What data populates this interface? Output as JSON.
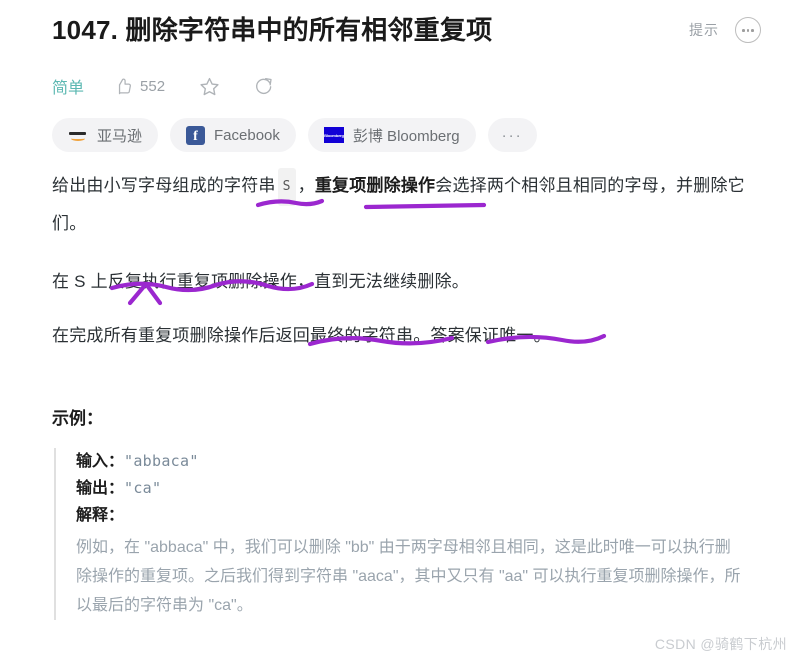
{
  "header": {
    "title": "1047. 删除字符串中的所有相邻重复项",
    "hint_label": "提示",
    "more_icon": "more-horizontal-circle-icon"
  },
  "meta": {
    "difficulty": "简单",
    "likes_icon": "thumbs-up-icon",
    "likes_count": "552",
    "favorite_icon": "star-icon",
    "share_icon": "share-icon"
  },
  "company_tags": {
    "items": [
      {
        "label": "亚马逊",
        "icon": "amazon-logo-icon"
      },
      {
        "label": "Facebook",
        "icon": "facebook-logo-icon"
      },
      {
        "label": "彭博 Bloomberg",
        "icon": "bloomberg-logo-icon"
      }
    ],
    "more_label": "···"
  },
  "description": {
    "p1_a": "给出由小写字母组成的字符串",
    "p1_code": "S",
    "p1_b": "，",
    "p1_bold": "重复项删除操作",
    "p1_c": "会选择两个相邻且相同的字母，并删除它们。",
    "p2": "在 S 上反复执行重复项删除操作，直到无法继续删除。",
    "p3": "在完成所有重复项删除操作后返回最终的字符串。答案保证唯一。"
  },
  "example": {
    "heading": "示例：",
    "input_label": "输入：",
    "input_value": "\"abbaca\"",
    "output_label": "输出：",
    "output_value": "\"ca\"",
    "explain_label": "解释：",
    "explain_text": "例如，在 \"abbaca\" 中，我们可以删除 \"bb\" 由于两字母相邻且相同，这是此时唯一可以执行删除操作的重复项。之后我们得到字符串 \"aaca\"，其中又只有 \"aa\" 可以执行重复项删除操作，所以最后的字符串为 \"ca\"。"
  },
  "watermark": {
    "text": "CSDN @骑鹤下杭州"
  },
  "colors": {
    "difficulty_teal": "#5cb8b2",
    "annotation_purple": "#9b27cf",
    "facebook_blue": "#3b5998",
    "bloomberg_blue": "#1200d6",
    "text_primary": "#2b3135",
    "text_muted": "#9aa4ad"
  }
}
